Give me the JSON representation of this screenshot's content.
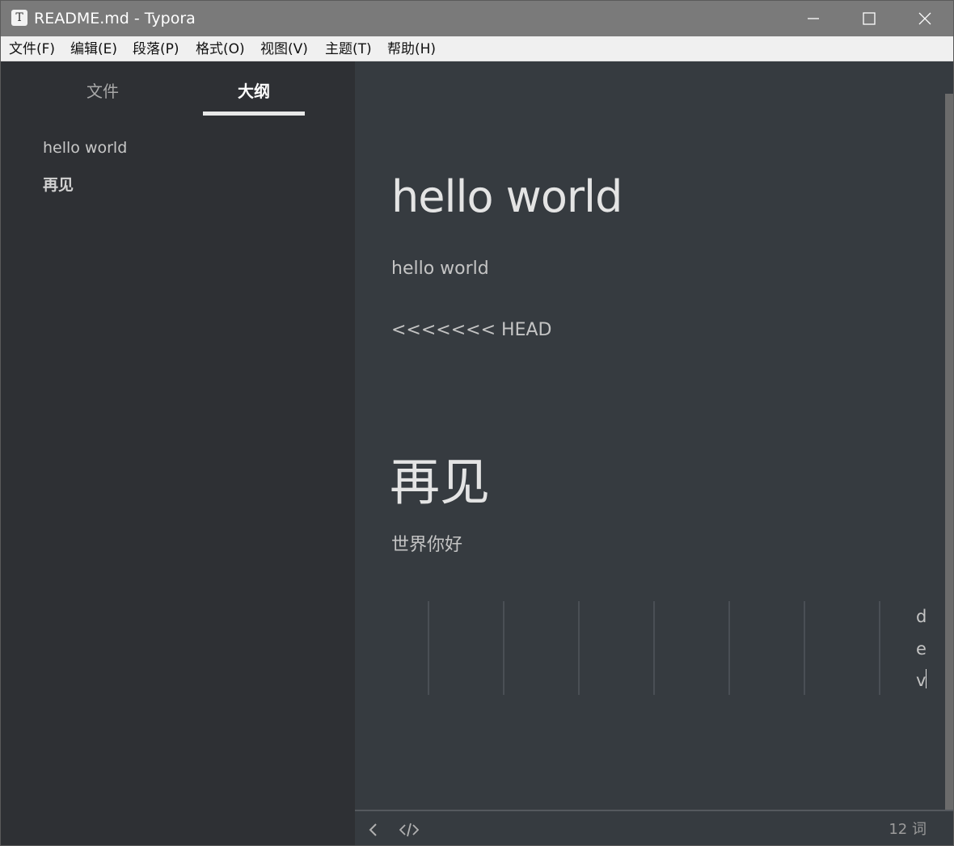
{
  "window": {
    "title": "README.md - Typora",
    "app_icon_glyph": "T",
    "controls": [
      "minimize-icon",
      "maximize-icon",
      "close-icon"
    ]
  },
  "menu": {
    "items": [
      "文件(F)",
      "编辑(E)",
      "段落(P)",
      "格式(O)",
      "视图(V)",
      "主题(T)",
      "帮助(H)"
    ]
  },
  "sidebar": {
    "tabs": [
      "文件",
      "大纲"
    ],
    "active_tab": "大纲",
    "outline": [
      "hello world",
      "再见"
    ]
  },
  "document": {
    "heading1": "hello world",
    "para1": "hello world",
    "para2": "<<<<<<< HEAD",
    "heading2": "再见",
    "para3": "世界你好",
    "vertical_chars": [
      "d",
      "e",
      "v"
    ]
  },
  "footer": {
    "word_count": "12 词",
    "icons": [
      "chevron-left-icon",
      "source-code-icon"
    ]
  },
  "colors": {
    "titlebar": "#7a7a7a",
    "menubar": "#f0f0f0",
    "sidebar": "#2e3034",
    "editor": "#363b40"
  }
}
